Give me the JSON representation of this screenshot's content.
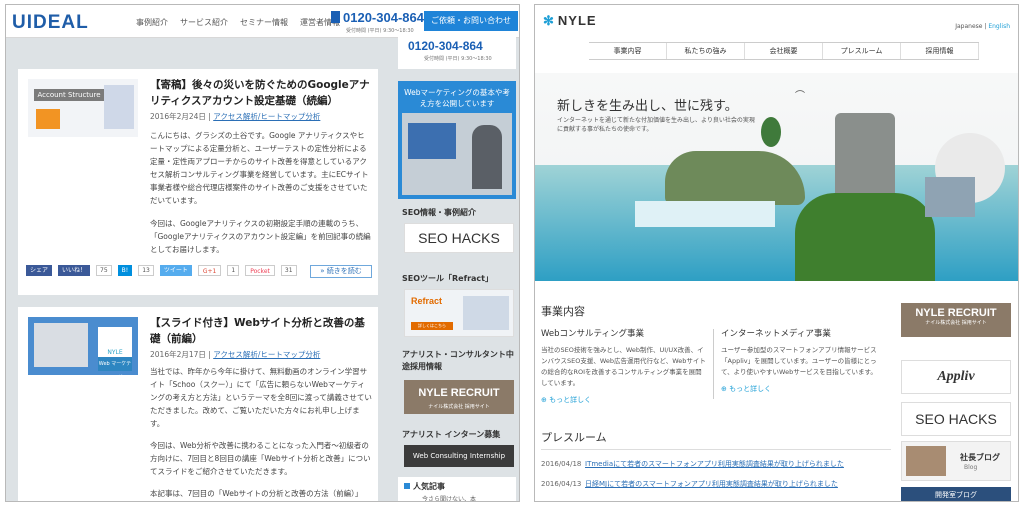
{
  "left": {
    "logo": "UIDEAL",
    "nav": [
      "事例紹介",
      "サービス紹介",
      "セミナー情報",
      "運営者情報"
    ],
    "tel": "0120-304-864",
    "tel_hours": "受付時間 (平日) 9:30〜18:30",
    "contact_button": "ご依頼・お問い合わせ",
    "articles": [
      {
        "thumb_label": "Account Structure",
        "title": "【寄稿】後々の災いを防ぐためのGoogleアナリティクスアカウント設定基礎（続編）",
        "date": "2016年2月24日",
        "category": "アクセス解析/ヒートマップ分析",
        "body1": "こんにちは、グラシズの土谷です。Google アナリティクスやヒートマップによる定量分析と、ユーザーテストの定性分析による定量・定性両アプローチからのサイト改善を得意としているアクセス解析コンサルティング事業を経営しています。主にECサイト事業者様や総合代理店様案件のサイト改善のご支援をさせていただいています。",
        "body2": "今回は、Googleアナリティクスの初期設定手順の連載のうち、「Googleアナリティクスのアカウント設定編」を前回記事の続編としてお届けします。",
        "social": {
          "share": "シェア",
          "like": "いいね！",
          "like_count": "75",
          "hatena": "B!",
          "hatena_count": "13",
          "tweet": "ツイート",
          "gplus": "G+1",
          "gplus_count": "1",
          "pocket": "Pocket",
          "pocket_count": "31"
        },
        "more": "続きを読む"
      },
      {
        "thumb_label": "Web マーケティング",
        "thumb_brand": "NYLE",
        "title": "【スライド付き】Webサイト分析と改善の基礎（前編）",
        "date": "2016年2月17日",
        "category": "アクセス解析/ヒートマップ分析",
        "body1": "当社では、昨年から今年に掛けて、無料動画のオンライン学習サイト「Schoo（スクー）」にて「広告に頼らないWebマーケティングの考え方と方法」というテーマを全8回に渡って講義させていただきました。改めて、ご覧いただいた方々にお礼申し上げます。",
        "body2": "今回は、Web分析や改善に携わることになった入門者〜初級者の方向けに、7回目と8回目の講座「Webサイト分析と改善」についてスライドをご紹介させていただきます。",
        "body3": "本記事は、7回目の「Webサイトの分析と改善の方法（前編）」"
      }
    ],
    "sidebar": {
      "tel": "0120-304-864",
      "tel_hours": "受付時間 (平日) 9:30〜18:30",
      "banner_text": "Webマーケティングの基本や考え方を公開しています",
      "seo_title": "SEO情報・事例紹介",
      "seo_logo": "SEO HACKS",
      "refract_title": "SEOツール「Refract」",
      "refract_logo": "Refract",
      "refract_btn": "詳しくはこちら",
      "recruit_title": "アナリスト・コンサルタント中途採用情報",
      "recruit_a": "NYLE RECRUIT",
      "recruit_b": "ナイル株式会社 採用サイト",
      "intern_title": "アナリスト インターン募集",
      "intern_banner": "Web Consulting Internship",
      "popular_title": "人気記事",
      "popular_item": "今さら聞けない、本"
    }
  },
  "right": {
    "logo": "NYLE",
    "lang_ja": "Japanese",
    "lang_en": "English",
    "nav": [
      "事業内容",
      "私たちの強み",
      "会社概要",
      "プレスルーム",
      "採用情報"
    ],
    "hero_title": "新しきを生み出し、世に残す。",
    "hero_sub": "インターネットを通じて新たな付加価値を生み出し、より良い社会の実現に貢献する事が私たちの使命です。",
    "biz_title": "事業内容",
    "col1_title": "Webコンサルティング事業",
    "col1_body": "当社のSEO技術を強みとし、Web制作、UI/UX改善、インバウスSEO支援、Web広告運用代行など、Webサイトの総合的なROIを改善するコンサルティング事業を展開しています。",
    "col1_more": "もっと詳しく",
    "col2_title": "インターネットメディア事業",
    "col2_body": "ユーザー参加型のスマートフォンアプリ情報サービス「Appliv」を展開しています。ユーザーの皆様にとって、より使いやすいWebサービスを目指しています。",
    "col2_more": "もっと詳しく",
    "press_title": "プレスルーム",
    "press": [
      {
        "date": "2016/04/18",
        "text": "ITmediaにて若者のスマートフォンアプリ利用実態調査結果が取り上げられました"
      },
      {
        "date": "2016/04/13",
        "text": "日経MJにて若者のスマートフォンアプリ利用実態調査結果が取り上げられました"
      }
    ],
    "side": {
      "recruit_a": "NYLE RECRUIT",
      "recruit_b": "ナイル株式会社 採用サイト",
      "appliv": "Appliv",
      "seo": "SEO HACKS",
      "blog_a": "社長ブログ",
      "blog_b": "Blog",
      "dev": "開発室ブログ"
    }
  }
}
